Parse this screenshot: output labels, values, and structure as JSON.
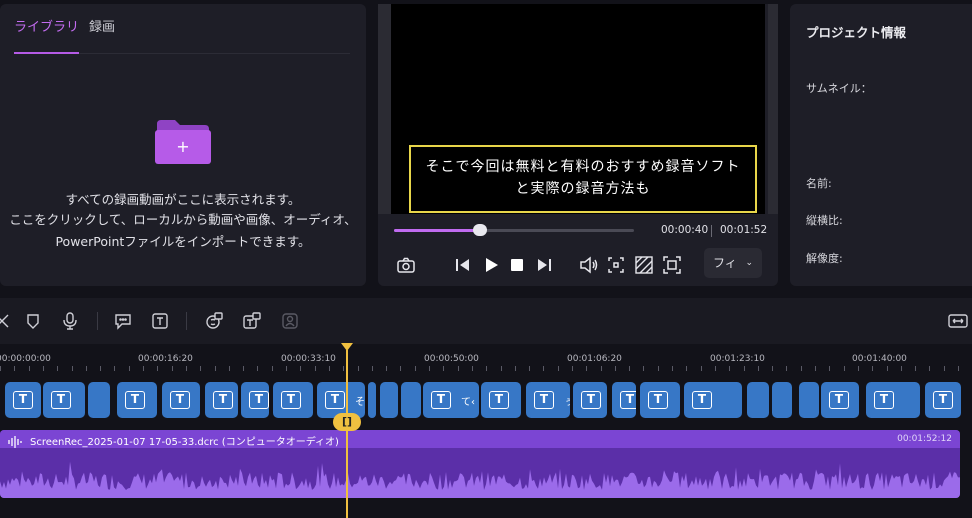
{
  "library": {
    "tabs": [
      {
        "label": "ライブラリ",
        "active": true
      },
      {
        "label": "録画",
        "active": false
      }
    ],
    "import_lines": [
      "すべての録画動画がここに表示されます。",
      "ここをクリックして、ローカルから動画や画像、オーディオ、",
      "PowerPointファイルをインポートできます。"
    ],
    "folder_color": "#b65be8"
  },
  "player": {
    "subtitle_lines": [
      "そこで今回は無料と有料のおすすめ録音ソフト",
      "と実際の録音方法も"
    ],
    "current_time": "00:00:40",
    "duration": "00:01:52",
    "progress": 0.36,
    "fit_label": "フィ",
    "controls": [
      "camera-icon",
      "prev-frame-icon",
      "play-icon",
      "stop-icon",
      "next-frame-icon",
      "volume-icon",
      "crop-icon",
      "transparency-icon",
      "fullscreen-icon"
    ]
  },
  "info": {
    "title": "プロジェクト情報",
    "labels": {
      "thumbnail": "サムネイル：",
      "name": "名前:",
      "aspect": "縦横比:",
      "resolution": "解像度:"
    }
  },
  "toolbar": {
    "tools": [
      "cut-icon",
      "marker-icon",
      "microphone-icon",
      "annotation-icon",
      "text-icon",
      "subtitle-icon",
      "text-to-speech-icon",
      "avatar-icon",
      "fit-timeline-icon"
    ]
  },
  "timeline": {
    "ruler_labels": [
      "00:00:00:00",
      "00:00:16:20",
      "00:00:33:10",
      "00:00:50:00",
      "00:01:06:20",
      "00:01:23:10",
      "00:01:40:00"
    ],
    "playhead_time": "00:00:40",
    "split_label": "[]",
    "subtitle_clips": [
      {
        "label": "T",
        "text": ""
      },
      {
        "label": "T",
        "text": ""
      },
      {
        "label": "",
        "text": ""
      },
      {
        "label": "T",
        "text": ""
      },
      {
        "label": "T",
        "text": ""
      },
      {
        "label": "T",
        "text": ""
      },
      {
        "label": "T",
        "text": ""
      },
      {
        "label": "T",
        "text": ""
      },
      {
        "label": "T",
        "text": "そ"
      },
      {
        "label": "",
        "text": ""
      },
      {
        "label": "",
        "text": ""
      },
      {
        "label": "",
        "text": ""
      },
      {
        "label": "T",
        "text": "て‹"
      },
      {
        "label": "T",
        "text": ""
      },
      {
        "label": "T",
        "text": "ぅ"
      },
      {
        "label": "T",
        "text": ""
      },
      {
        "label": "T",
        "text": ""
      },
      {
        "label": "T",
        "text": ""
      },
      {
        "label": "T",
        "text": ""
      },
      {
        "label": "",
        "text": ""
      },
      {
        "label": "",
        "text": ""
      },
      {
        "label": "",
        "text": ""
      },
      {
        "label": "T",
        "text": ""
      },
      {
        "label": "T",
        "text": ""
      },
      {
        "label": "T",
        "text": ""
      }
    ],
    "audio": {
      "name": "ScreenRec_2025-01-07 17-05-33.dcrc (コンピュータオーディオ)",
      "duration": "00:01:52:12"
    },
    "colors": {
      "subtitle_clip": "#3777c6",
      "audio_track": "#5b2fa8",
      "playhead": "#f0c040"
    }
  }
}
